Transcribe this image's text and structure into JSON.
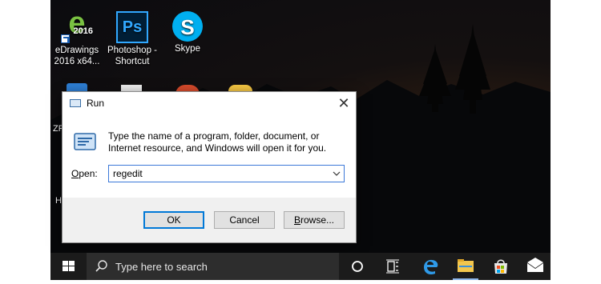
{
  "desktop": {
    "icons": [
      {
        "label": "eDrawings 2016 x64...",
        "badge": "2016",
        "icon": "edrawings-icon"
      },
      {
        "label": "Photoshop - Shortcut",
        "glyph": "Ps",
        "icon": "photoshop-icon"
      },
      {
        "label": "Skype",
        "glyph": "S",
        "icon": "skype-icon"
      }
    ],
    "partial_labels": [
      "ZP",
      "H"
    ]
  },
  "run": {
    "title": "Run",
    "description": "Type the name of a program, folder, document, or Internet resource, and Windows will open it for you.",
    "open_label_first": "O",
    "open_label_rest": "pen:",
    "input_value": "regedit",
    "ok_label": "OK",
    "cancel_label": "Cancel",
    "browse_label_first": "B",
    "browse_label_rest": "rowse...",
    "close_glyph": "✕"
  },
  "taskbar": {
    "search_placeholder": "Type here to search",
    "pinned": [
      "cortana-icon",
      "task-view-icon",
      "edge-icon",
      "file-explorer-icon",
      "store-icon",
      "mail-icon"
    ]
  },
  "colors": {
    "accent": "#0078d7",
    "taskbar": "#1b1b1b",
    "search_box": "#2d2d2d"
  }
}
